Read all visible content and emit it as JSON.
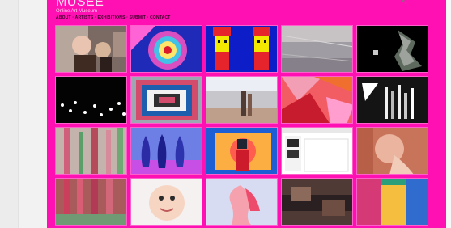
{
  "page": {
    "title": "MUSEE",
    "subtitle": "Online Art Museum",
    "link_line": "ABOUT · ARTISTS · EXHIBITIONS · SUBMIT · CONTACT"
  },
  "tiles": [
    {
      "name": "artwork-tile-1"
    },
    {
      "name": "artwork-tile-2"
    },
    {
      "name": "artwork-tile-3"
    },
    {
      "name": "artwork-tile-4"
    },
    {
      "name": "artwork-tile-5"
    },
    {
      "name": "artwork-tile-6"
    },
    {
      "name": "artwork-tile-7"
    },
    {
      "name": "artwork-tile-8"
    },
    {
      "name": "artwork-tile-9"
    },
    {
      "name": "artwork-tile-10"
    },
    {
      "name": "artwork-tile-11"
    },
    {
      "name": "artwork-tile-12"
    },
    {
      "name": "artwork-tile-13"
    },
    {
      "name": "artwork-tile-14"
    },
    {
      "name": "artwork-tile-15"
    },
    {
      "name": "artwork-tile-16"
    },
    {
      "name": "artwork-tile-17"
    },
    {
      "name": "artwork-tile-18"
    },
    {
      "name": "artwork-tile-19"
    },
    {
      "name": "artwork-tile-20"
    }
  ],
  "colors": {
    "page_bg": "#ff10b2",
    "tile_border": "#ff5fcb"
  }
}
